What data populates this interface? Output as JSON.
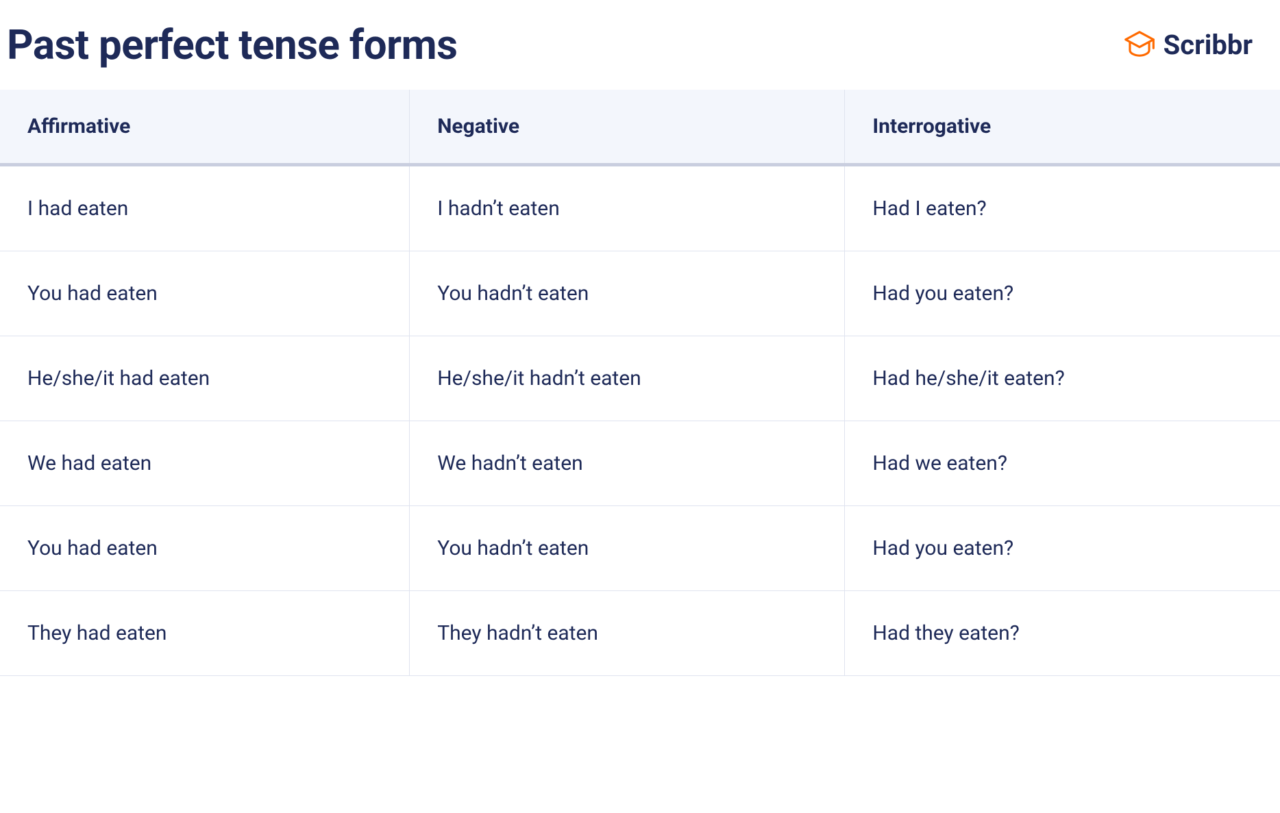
{
  "title": "Past perfect tense forms",
  "brand": "Scribbr",
  "columns": [
    "Affirmative",
    "Negative",
    "Interrogative"
  ],
  "rows": [
    {
      "affirmative": "I had eaten",
      "negative": "I hadn’t eaten",
      "interrogative": "Had I eaten?"
    },
    {
      "affirmative": "You had eaten",
      "negative": "You hadn’t eaten",
      "interrogative": "Had you eaten?"
    },
    {
      "affirmative": "He/she/it had eaten",
      "negative": "He/she/it hadn’t eaten",
      "interrogative": "Had he/she/it eaten?"
    },
    {
      "affirmative": "We had eaten",
      "negative": "We hadn’t eaten",
      "interrogative": "Had we eaten?"
    },
    {
      "affirmative": "You had eaten",
      "negative": "You hadn’t eaten",
      "interrogative": "Had you eaten?"
    },
    {
      "affirmative": "They had eaten",
      "negative": "They hadn’t eaten",
      "interrogative": "Had they eaten?"
    }
  ]
}
